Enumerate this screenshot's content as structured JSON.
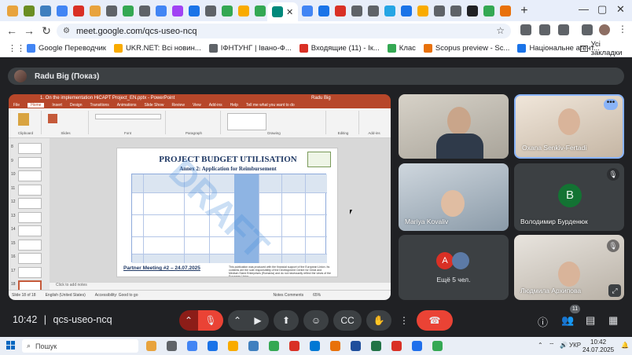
{
  "browser": {
    "url": "meet.google.com/qcs-useo-ncq",
    "tab_colors": [
      "#e8a33d",
      "#6b8e23",
      "#3f7fbf",
      "#4285f4",
      "#d93025",
      "#e8a33d",
      "#5f6368",
      "#34a853",
      "#5f6368",
      "#4285f4",
      "#a142f4",
      "#1a73e8",
      "#5f6368",
      "#34a853",
      "#f9ab00",
      "#34a853"
    ],
    "right_tab_colors": [
      "#4285f4",
      "#1a73e8",
      "#d93025",
      "#5f6368",
      "#5f6368",
      "#26a5e4",
      "#1a73e8",
      "#f9ab00",
      "#5f6368",
      "#5f6368",
      "#202124",
      "#34a853",
      "#e8710a"
    ],
    "bookmarks": [
      {
        "label": "Google Переводчик",
        "color": "#4285f4"
      },
      {
        "label": "UKR.NET: Всі новин...",
        "color": "#f9ab00"
      },
      {
        "label": "ІФНТУНГ | Івано-Ф...",
        "color": "#5f6368"
      },
      {
        "label": "Входящие (11) - Ік...",
        "color": "#d93025"
      },
      {
        "label": "Клас",
        "color": "#34a853"
      },
      {
        "label": "Scopus preview - Sc...",
        "color": "#e8710a"
      },
      {
        "label": "Національне агент...",
        "color": "#1a73e8"
      }
    ],
    "all_bookmarks_label": "Усі закладки"
  },
  "meet": {
    "presenter_label": "Radu Big (Показ)",
    "time": "10:42",
    "separator": "|",
    "meeting_code": "qcs-useo-ncq",
    "participant_count": "11",
    "participants": [
      {
        "name": "",
        "muted": false
      },
      {
        "name": "Oxana Senkiv-Fertadi",
        "muted": false
      },
      {
        "name": "Mariya Kovaliv",
        "muted": false
      },
      {
        "name": "Володимир Бурденюк",
        "muted": true,
        "initial": "B"
      },
      {
        "name": "Ещё 5 чел.",
        "initial": "A"
      },
      {
        "name": "Людмила Архипова",
        "muted": true
      }
    ],
    "more_dots": "•••"
  },
  "ppt": {
    "title_bar": "1. On the implementation HiCAPT Project_EN.pptx  -  PowerPoint",
    "user": "Radu Big",
    "tabs": [
      "File",
      "Home",
      "Insert",
      "Design",
      "Transitions",
      "Animations",
      "Slide Show",
      "Review",
      "View",
      "Add-ins",
      "Help",
      "Tell me what you want to do"
    ],
    "groups": [
      "Clipboard",
      "Slides",
      "Font",
      "Paragraph",
      "Drawing",
      "Editing",
      "Add-ins"
    ],
    "slide_title": "PROJECT BUDGET UTILISATION",
    "slide_subtitle": "Annex 2: Application for Reimbursement",
    "draft_watermark": "DRAFT",
    "slide_footer": "Partner Meeting #2 – 24.07.2025",
    "slide_note": "This publication was produced with the financial support of the European Union. Its contents are the sole responsibility of the Development Centre for Great and Medium Sized Enterprises (Romania) and do not necessarily reflect the views of the European Union.",
    "notes_placeholder": "Click to add notes",
    "status_left": "Slide 18 of 18",
    "status_lang": "English (United States)",
    "status_access": "Accessibility: Good to go",
    "status_right": "Notes   Comments",
    "zoom": "65%",
    "thumb_numbers": [
      "8",
      "9",
      "10",
      "11",
      "12",
      "13",
      "14",
      "15",
      "16",
      "17",
      "18"
    ]
  },
  "taskbar": {
    "search_placeholder": "Пошук",
    "lang": "УКР",
    "time": "10:42",
    "date": "24.07.2025",
    "app_colors": [
      "#e8a33d",
      "#5f6368",
      "#4285f4",
      "#1a73e8",
      "#f9ab00",
      "#3f7fbf",
      "#34a853",
      "#d93025",
      "#0078d4",
      "#e8710a",
      "#1e4e9c",
      "#217346",
      "#d93025",
      "#1f6feb",
      "#34a853"
    ]
  }
}
